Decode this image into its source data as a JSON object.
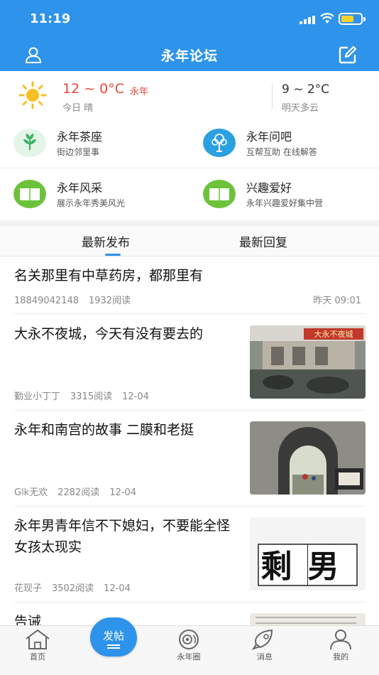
{
  "status_bar": {
    "time": "11:19"
  },
  "nav": {
    "title": "永年论坛"
  },
  "weather": {
    "today_temp": "12 ~ 0°C",
    "city": "永年",
    "today_desc": "今日 晴",
    "tomorrow_temp": "9 ~ 2°C",
    "tomorrow_desc": "明天多云"
  },
  "categories": [
    {
      "name": "永年茶座",
      "desc": "街边邻里事",
      "icon": "leaf-icon",
      "color": "#3cb060"
    },
    {
      "name": "永年问吧",
      "desc": "互帮互助 在线解答",
      "icon": "tree-icon",
      "color": "#2aa0e0"
    },
    {
      "name": "永年风采",
      "desc": "展示永年秀美风光",
      "icon": "book-icon",
      "color": "#6cc23a"
    },
    {
      "name": "兴趣爱好",
      "desc": "永年兴趣爱好集中营",
      "icon": "book-icon",
      "color": "#6cc23a"
    }
  ],
  "tabs": [
    {
      "label": "最新发布",
      "active": true
    },
    {
      "label": "最新回复",
      "active": false
    }
  ],
  "posts": [
    {
      "title": "名关那里有中草药房，都那里有",
      "author": "18849042148",
      "reads": "1932阅读",
      "time": "昨天 09:01",
      "has_image": false
    },
    {
      "title": "大永不夜城，今天有没有要去的",
      "author": "勤业小丁丁",
      "reads": "3315阅读",
      "time": "12-04",
      "has_image": true,
      "image_text": "大永不夜城"
    },
    {
      "title": "永年和南宫的故事 二膜和老挺",
      "author": "Glk无欢",
      "reads": "2282阅读",
      "time": "12-04",
      "has_image": true
    },
    {
      "title": "永年男青年信不下媳妇，不要能全怪女孩太现实",
      "author": "花现子",
      "reads": "3502阅读",
      "time": "12-04",
      "has_image": true,
      "image_text": "剩男"
    },
    {
      "title": "告诫",
      "author": "",
      "reads": "",
      "time": "",
      "has_image": true
    }
  ],
  "fab": {
    "label": "发帖"
  },
  "tabbar": [
    {
      "label": "首页",
      "icon": "home-icon"
    },
    {
      "label": "永年圈",
      "icon": "circle-icon"
    },
    {
      "label": "消息",
      "icon": "message-icon"
    },
    {
      "label": "我的",
      "icon": "profile-icon"
    }
  ],
  "colors": {
    "primary": "#2e93ea",
    "temp_red": "#e24a3b"
  }
}
